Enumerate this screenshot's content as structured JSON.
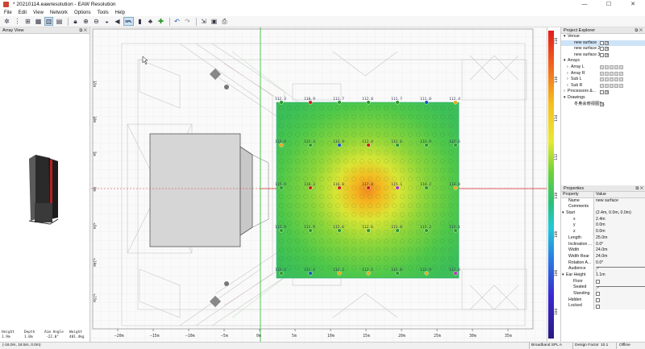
{
  "window": {
    "title": "* 20210114.eawresolution - EAW Resolution",
    "minimize": "—",
    "maximize": "☐",
    "close": "✕"
  },
  "menu": [
    "File",
    "Edit",
    "View",
    "Network",
    "Options",
    "Tools",
    "Help"
  ],
  "toolbar": {
    "icons": [
      "speaker-tool-icon",
      "array-tool-icon",
      "sub-tool-icon",
      "chart-tool-icon",
      "bar-tool-icon",
      "grid-tool-icon",
      "lock-icon",
      "zoom-in-icon",
      "zoom-out-icon",
      "measure-icon",
      "sound-icon",
      "spl-icon",
      "speaker-icon",
      "tree-icon",
      "add-icon",
      "undo-icon",
      "redo-icon",
      "export-icon",
      "image-icon",
      "print-icon"
    ],
    "spl_label": "SPL"
  },
  "array_view": {
    "title": "Array View",
    "stats": [
      {
        "label": "Height",
        "value": "1.9m"
      },
      {
        "label": "Depth",
        "value": "1.0m"
      },
      {
        "label": "Aim Angle",
        "value": "-22.0°"
      },
      {
        "label": "Weight",
        "value": "401.4kg"
      }
    ]
  },
  "canvas": {
    "x_ticks": [
      "−20m",
      "−15m",
      "−10m",
      "−5m",
      "0m",
      "5m",
      "10m",
      "15m",
      "20m",
      "25m",
      "30m",
      "35m"
    ],
    "y_ticks": [
      "15m",
      "10m",
      "5m",
      "0m",
      "−5m",
      "−10m",
      "−15m"
    ],
    "grid_values": [
      [
        "112.3",
        "110.9",
        "111.7",
        "112.0",
        "111.7",
        "111.8",
        "112.4"
      ],
      [
        "112.9",
        "112.3",
        "112.9",
        "112.4",
        "112.6",
        "111.9",
        "112.6"
      ],
      [
        "115.9",
        "116.3",
        "116.8",
        "117.8",
        "115.1",
        "114.2",
        "113.8"
      ],
      [
        "111.9",
        "111.9",
        "112.6",
        "112.6",
        "111.0",
        "111.2",
        "112.1"
      ],
      [
        "112.4",
        "111.1",
        "111.1",
        "112.5",
        "111.0",
        "112.9",
        "112.0"
      ]
    ],
    "dot_colors": [
      [
        "#2a9a2a",
        "#d02020",
        "#2a9a2a",
        "#2a9a2a",
        "#2a9a2a",
        "#1d57c4",
        "#e6a91a"
      ],
      [
        "#e6a91a",
        "#2a9a2a",
        "#1d57c4",
        "#d02020",
        "#2a9a2a",
        "#2a9a2a",
        "#2a9a2a"
      ],
      [
        "#2a9a2a",
        "#d02020",
        "#d02020",
        "#d02020",
        "#b03ab0",
        "#2a9a2a",
        "#e6a91a"
      ],
      [
        "#2a9a2a",
        "#2a9a2a",
        "#2a9a2a",
        "#2a9a2a",
        "#2a9a2a",
        "#2a9a2a",
        "#2a9a2a"
      ],
      [
        "#2a9a2a",
        "#1d57c4",
        "#e6a91a",
        "#e6a91a",
        "#2a9a2a",
        "#e6a91a",
        "#b03ab0"
      ]
    ]
  },
  "spl_scale": {
    "ticks": [
      "118",
      "116",
      "114",
      "112",
      "110",
      "108",
      "106",
      "104"
    ]
  },
  "project_explorer": {
    "title": "Project Explorer",
    "rows": [
      {
        "label": "Venue",
        "indent": 0,
        "arrow": "▾",
        "checks": 0,
        "selected": false
      },
      {
        "label": "new surface",
        "indent": 2,
        "arrow": "",
        "checks": 2,
        "selected": true
      },
      {
        "label": "new surface 2",
        "indent": 2,
        "arrow": "",
        "checks": 2,
        "selected": false
      },
      {
        "label": "new surface 3",
        "indent": 2,
        "arrow": "",
        "checks": 2,
        "selected": false
      },
      {
        "label": "Arrays",
        "indent": 0,
        "arrow": "▾",
        "checks": 0,
        "selected": false
      },
      {
        "label": "Array L",
        "indent": 1,
        "arrow": "›",
        "checks": 5,
        "selected": false
      },
      {
        "label": "Array R",
        "indent": 1,
        "arrow": "›",
        "checks": 5,
        "selected": false
      },
      {
        "label": "Sub L",
        "indent": 1,
        "arrow": "›",
        "checks": 5,
        "selected": false
      },
      {
        "label": "Sub R",
        "indent": 1,
        "arrow": "›",
        "checks": 5,
        "selected": false
      },
      {
        "label": "Processors &...",
        "indent": 0,
        "arrow": "›",
        "checks": 2,
        "selected": false
      },
      {
        "label": "Drawings",
        "indent": 0,
        "arrow": "▾",
        "checks": 0,
        "selected": false
      },
      {
        "label": "冬奥会俯视图T...",
        "indent": 2,
        "arrow": "",
        "checks": 1,
        "selected": false
      }
    ]
  },
  "properties": {
    "title": "Properties",
    "header": {
      "k": "Property",
      "v": "Value"
    },
    "rows": [
      {
        "k": "Name",
        "v": "new surface",
        "indent": 1,
        "type": "text"
      },
      {
        "k": "Comments",
        "v": "",
        "indent": 1,
        "type": "text"
      },
      {
        "k": "Start",
        "v": "(2.4m, 0.0m, 0.0m)",
        "indent": 0,
        "type": "group"
      },
      {
        "k": "x",
        "v": "2.4m",
        "indent": 3,
        "type": "text"
      },
      {
        "k": "y",
        "v": "0.0m",
        "indent": 3,
        "type": "text"
      },
      {
        "k": "z",
        "v": "0.0m",
        "indent": 3,
        "type": "text"
      },
      {
        "k": "Length",
        "v": "25.0m",
        "indent": 1,
        "type": "text"
      },
      {
        "k": "Inclination ...",
        "v": "0.0°",
        "indent": 1,
        "type": "text"
      },
      {
        "k": "Width",
        "v": "24.0m",
        "indent": 1,
        "type": "text"
      },
      {
        "k": "Width Rear",
        "v": "24.0m",
        "indent": 1,
        "type": "text"
      },
      {
        "k": "Rotation A...",
        "v": "0.0°",
        "indent": 1,
        "type": "text"
      },
      {
        "k": "Audience",
        "v": "",
        "indent": 1,
        "type": "check"
      },
      {
        "k": "Ear Height",
        "v": "1.1m",
        "indent": 0,
        "type": "group"
      },
      {
        "k": "Floor",
        "v": "",
        "indent": 3,
        "type": "uncheck"
      },
      {
        "k": "Seated",
        "v": "",
        "indent": 3,
        "type": "check"
      },
      {
        "k": "Standing",
        "v": "",
        "indent": 3,
        "type": "uncheck"
      },
      {
        "k": "Hidden",
        "v": "",
        "indent": 1,
        "type": "uncheck"
      },
      {
        "k": "Locked",
        "v": "",
        "indent": 1,
        "type": "uncheck"
      }
    ]
  },
  "statusbar": {
    "coords": "(-16.0m, 18.5m, 0.0m)",
    "mode": "Broadband SPL A",
    "design_factor_label": "Design Factor",
    "design_factor": "10.1",
    "status": "Offline"
  },
  "colors": {
    "accent": "#3a8fd6",
    "selection": "#cde3f7"
  }
}
